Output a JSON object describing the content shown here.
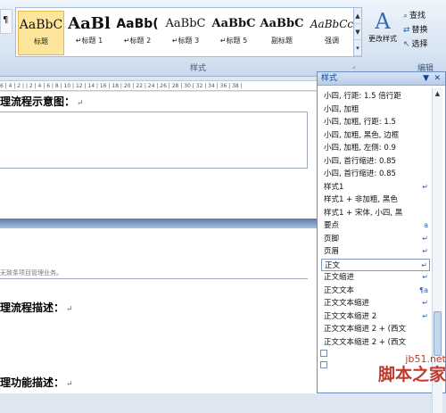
{
  "ribbon": {
    "style_tiles": [
      {
        "preview": "AaBbC",
        "label": "标题"
      },
      {
        "preview": "AaBl",
        "label": "↵标题 1"
      },
      {
        "preview": "AaBb(",
        "label": "↵标题 2"
      },
      {
        "preview": "AaBbC",
        "label": "↵标题 3"
      },
      {
        "preview": "AaBbC",
        "label": "↵标题 5"
      },
      {
        "preview": "AaBbC",
        "label": "副标题"
      },
      {
        "preview": "AaBbCc",
        "label": "强调"
      }
    ],
    "change_styles_label": "更改样式",
    "group_label": "样式",
    "find_label": "查找",
    "replace_label": "替换",
    "select_label": "选择",
    "edit_group_label": "编辑"
  },
  "ruler_text": "6 | 4 | 2 | | 2 | 4 | 6 | 8 | 10 | 12 | 14 | 16 | 18 | 20 | 22 | 24 | 26 | 28 | 30 | 32 | 34 | 36 | 38 |",
  "document": {
    "heading1": "理流程示意图：",
    "header_text": "无致条项目管理业务。",
    "heading2": "理流程描述：",
    "heading3": "理功能描述：",
    "para_mark": "↵"
  },
  "styles_pane": {
    "title": "样式",
    "items": [
      {
        "label": "小四, 行距: 1.5 倍行距",
        "mark": ""
      },
      {
        "label": "小四, 加粗",
        "mark": ""
      },
      {
        "label": "小四, 加粗, 行距: 1.5",
        "mark": ""
      },
      {
        "label": "小四, 加粗, 黑色, 边框",
        "mark": ""
      },
      {
        "label": "小四, 加粗, 左侧: 0.9",
        "mark": ""
      },
      {
        "label": "小四, 首行缩进: 0.85",
        "mark": ""
      },
      {
        "label": "小四, 首行缩进: 0.85",
        "mark": ""
      },
      {
        "label": "样式1",
        "mark": "↵"
      },
      {
        "label": "样式1 + 非加粗, 黑色",
        "mark": ""
      },
      {
        "label": "样式1 + 宋体, 小四, 黑",
        "mark": ""
      },
      {
        "label": "要点",
        "mark": "a"
      },
      {
        "label": "页脚",
        "mark": "↵"
      },
      {
        "label": "页眉",
        "mark": "↵"
      },
      {
        "label": "正文",
        "mark": "↵",
        "selected": true
      },
      {
        "label": "正文缩进",
        "mark": "↵"
      },
      {
        "label": "正文文本",
        "mark": "¶a"
      },
      {
        "label": "正文文本缩进",
        "mark": "↵"
      },
      {
        "label": "正文文本缩进 2",
        "mark": "↵"
      },
      {
        "label": "正文文本缩进 2 + (西文",
        "mark": ""
      },
      {
        "label": "正文文本缩进 2 + (西文",
        "mark": ""
      }
    ]
  },
  "watermark": {
    "url": "jb51.net",
    "name": "脚本之家"
  }
}
